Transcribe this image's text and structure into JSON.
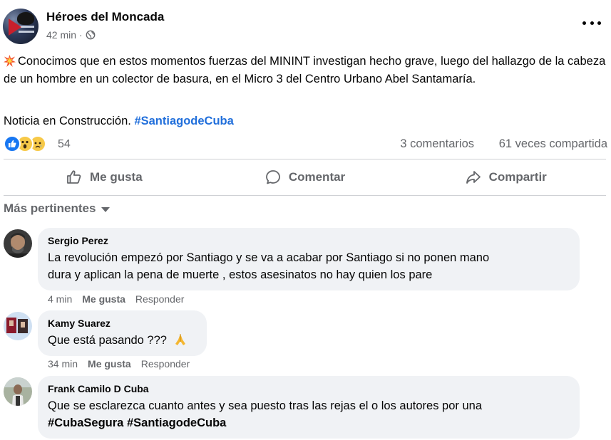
{
  "post": {
    "page_name": "Héroes del Moncada",
    "time": "42 min",
    "meta_separator": "·",
    "text": "Conocimos que en estos momentos fuerzas del MININT investigan hecho grave, luego del hallazgo de la cabeza de un hombre en un colector de basura, en el Micro 3 del Centro Urbano Abel Santamaría.",
    "text2": "Noticia en Construcción.",
    "hashtag": "#SantiagodeCuba",
    "icons": {
      "lead": "collision-emoji-icon",
      "privacy": "globe-icon",
      "menu": "more-options-icon"
    }
  },
  "stats": {
    "reaction_count": "54",
    "reactions": [
      "like",
      "wow",
      "sad"
    ],
    "comments": "3 comentarios",
    "shares": "61 veces compartida"
  },
  "actions": {
    "like": "Me gusta",
    "comment": "Comentar",
    "share": "Compartir"
  },
  "sort": {
    "label": "Más pertinentes"
  },
  "comments": [
    {
      "author": "Sergio Perez",
      "text_line1": "La revolución empezó por Santiago y se va a acabar por Santiago si no ponen mano",
      "text_line2": "dura y aplican la pena de muerte , estos asesinatos no hay quien los pare",
      "time": "4 min",
      "like": "Me gusta",
      "reply": "Responder"
    },
    {
      "author": "Kamy Suarez",
      "text": "Que está pasando ???",
      "emoji": "folded-hands-icon",
      "time": "34 min",
      "like": "Me gusta",
      "reply": "Responder"
    },
    {
      "author": "Frank Camilo D Cuba",
      "text_line1": "Que se esclarezca cuanto antes y sea puesto tras las rejas el o los autores por una",
      "tag1": "#CubaSegura",
      "tag2": "#SantiagodeCuba"
    }
  ],
  "colors": {
    "hashtag": "#216fdb",
    "secondary_text": "#65676b",
    "bubble": "#f0f2f5",
    "like_blue": "#1877f2"
  }
}
